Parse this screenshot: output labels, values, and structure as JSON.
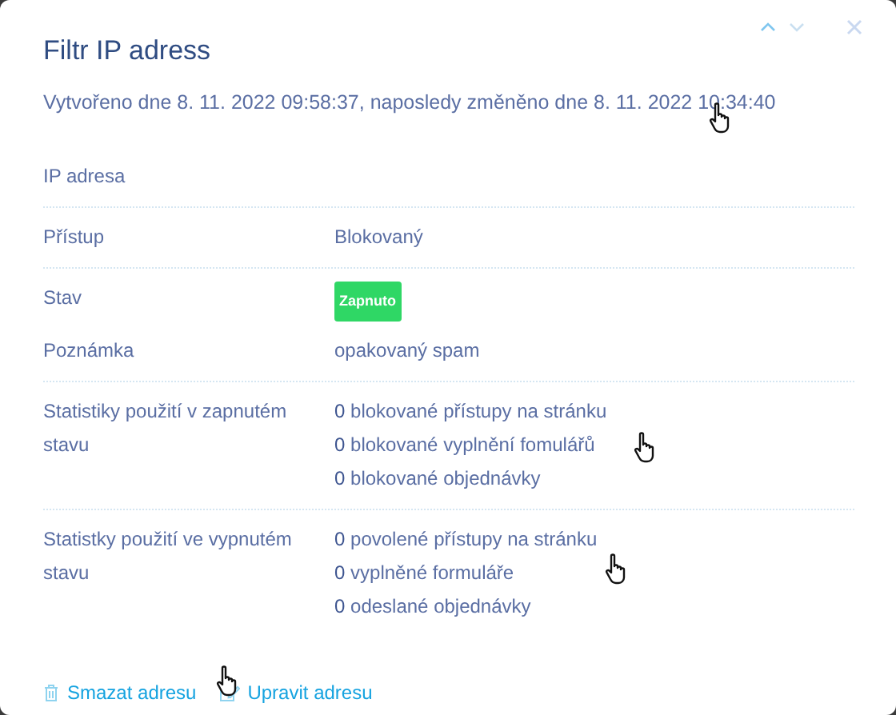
{
  "dialog": {
    "title": "Filtr IP adress",
    "subtitle": "Vytvořeno dne 8. 11. 2022 09:58:37, naposledy změněno dne 8. 11. 2022 10:34:40",
    "nav": {
      "previous_disabled": false,
      "next_disabled": true
    }
  },
  "sections": [
    [
      {
        "label": "IP adresa",
        "kind": "empty"
      }
    ],
    [
      {
        "label": "Přístup",
        "kind": "text",
        "value": "Blokovaný"
      }
    ],
    [
      {
        "label": "Stav",
        "kind": "badge",
        "value": "Zapnuto",
        "color": "#2fd765"
      },
      {
        "label": "Poznámka",
        "kind": "text",
        "value": "opakovaný spam"
      }
    ],
    [
      {
        "label": "Statistiky použití v zapnutém stavu",
        "kind": "lines",
        "lines": [
          "**0** blokované přístupy na stránku",
          "**0** blokované vyplnění fomulářů",
          "**0** blokované objednávky"
        ]
      }
    ],
    [
      {
        "label": "Statistky použití ve vypnutém stavu",
        "kind": "lines",
        "lines": [
          "**0** povolené přístupy na stránku",
          "**0** vyplněné formuláře",
          "**0** odeslané objednávky"
        ]
      }
    ]
  ],
  "actions": [
    {
      "kind": "delete",
      "label": "Smazat adresu"
    },
    {
      "kind": "edit",
      "label": "Upravit adresu"
    }
  ]
}
